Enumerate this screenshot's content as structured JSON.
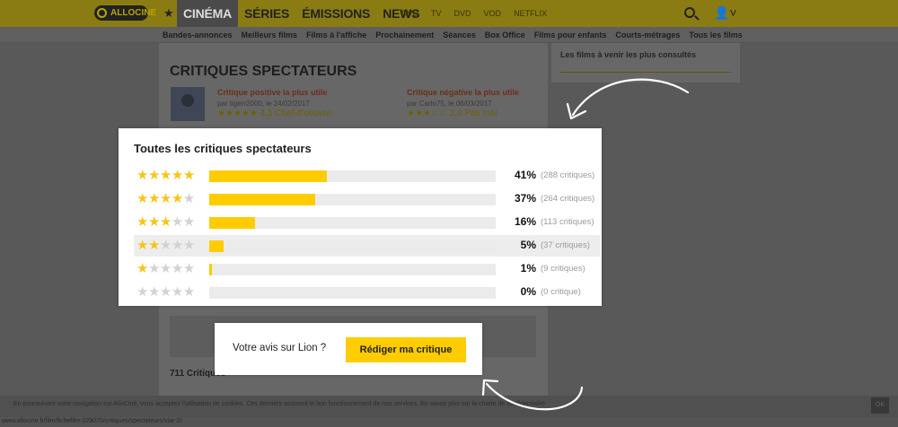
{
  "topbar": {
    "logo": "ALLOCINE",
    "nav_main": [
      "CINÉMA",
      "SÉRIES",
      "ÉMISSIONS",
      "NEWS"
    ],
    "nav_small": [
      "DVD",
      "TV",
      "DVD",
      "VOD",
      "NETFLIX"
    ]
  },
  "subnav": [
    "Bandes-annonces",
    "Meilleurs films",
    "Films à l'affiche",
    "Prochainement",
    "Séances",
    "Box Office",
    "Films pour enfants",
    "Courts-métrages",
    "Tous les films"
  ],
  "sidebar": {
    "title": "Les films à venir les plus consultés"
  },
  "background": {
    "section_title": "CRITIQUES SPECTATEURS",
    "positive_label": "Critique positive la plus utile",
    "positive_by": "par tigerr2000, le 24/02/2017",
    "positive_score": "4,5 Chef-d'oeuvre",
    "negative_label": "Critique négative la plus utile",
    "negative_by": "par Carlo75, le 06/03/2017",
    "negative_score": "2,0 Pas mal",
    "count_label": "711 Critiques"
  },
  "ratings": {
    "title": "Toutes les critiques spectateurs",
    "rows": [
      {
        "stars": 5,
        "percent": 41,
        "percent_label": "41%",
        "count_label": "(288 critiques)"
      },
      {
        "stars": 4,
        "percent": 37,
        "percent_label": "37%",
        "count_label": "(264 critiques)"
      },
      {
        "stars": 3,
        "percent": 16,
        "percent_label": "16%",
        "count_label": "(113 critiques)"
      },
      {
        "stars": 2,
        "percent": 5,
        "percent_label": "5%",
        "count_label": "(37 critiques)"
      },
      {
        "stars": 1,
        "percent": 1,
        "percent_label": "1%",
        "count_label": "(9 critiques)"
      },
      {
        "stars": 0,
        "percent": 0,
        "percent_label": "0%",
        "count_label": "(0 critique)"
      }
    ],
    "highlighted_row": 3,
    "star_color": "#f5c518",
    "bar_color": "#fecc00"
  },
  "opinion": {
    "question": "Votre avis sur Lion ?",
    "button": "Rédiger ma critique"
  },
  "cookie": {
    "text": "En poursuivant votre navigation sur AlloCiné, vous acceptez l'utilisation de cookies. Ces derniers assurent le bon fonctionnement de nos services. En savoir plus sur la charte de confidentialité",
    "ok": "OK"
  },
  "statusbar": {
    "url": "www.allocine.fr/film/fichefilm-229070/critiques/spectateurs/star-2/"
  }
}
